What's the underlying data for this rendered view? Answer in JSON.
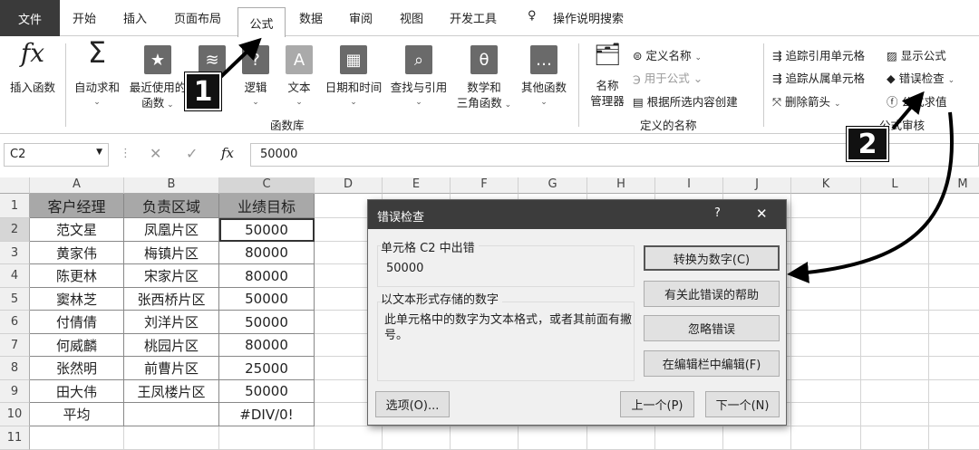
{
  "tabs": {
    "file": "文件",
    "home": "开始",
    "insert": "插入",
    "layout": "页面布局",
    "formulas": "公式",
    "data": "数据",
    "review": "审阅",
    "view": "视图",
    "developer": "开发工具",
    "search": "操作说明搜索"
  },
  "ribbon": {
    "insert_function": "插入函数",
    "autosum": "自动求和",
    "recent1": "最近使用的",
    "recent2": "函数",
    "logic": "逻辑",
    "text": "文本",
    "datetime": "日期和时间",
    "lookup": "查找与引用",
    "math1": "数学和",
    "math2": "三角函数",
    "other": "其他函数",
    "group_lib": "函数库",
    "name_mgr1": "名称",
    "name_mgr2": "管理器",
    "define_name": "定义名称",
    "use_in_formula": "用于公式",
    "create_from_sel": "根据所选内容创建",
    "group_names": "定义的名称",
    "trace_prec": "追踪引用单元格",
    "trace_dep": "追踪从属单元格",
    "remove_arrows": "删除箭头",
    "show_formulas": "显示公式",
    "error_check": "错误检查",
    "eval_formula": "公式求值",
    "group_audit": "公式审核"
  },
  "formula_bar": {
    "name_box": "C2",
    "fx": "fx",
    "value": "50000"
  },
  "columns": [
    "A",
    "B",
    "C",
    "D",
    "E",
    "F",
    "G",
    "H",
    "I",
    "J",
    "K",
    "L",
    "M"
  ],
  "rows": [
    [
      "客户经理",
      "负责区域",
      "业绩目标"
    ],
    [
      "范文星",
      "凤凰片区",
      "50000"
    ],
    [
      "黄家伟",
      "梅镇片区",
      "80000"
    ],
    [
      "陈更林",
      "宋家片区",
      "80000"
    ],
    [
      "窦林芝",
      "张西桥片区",
      "50000"
    ],
    [
      "付倩倩",
      "刘洋片区",
      "50000"
    ],
    [
      "何威麟",
      "桃园片区",
      "80000"
    ],
    [
      "张然明",
      "前曹片区",
      "25000"
    ],
    [
      "田大伟",
      "王凤楼片区",
      "50000"
    ],
    [
      "平均",
      "",
      "#DIV/0!"
    ]
  ],
  "row_numbers": [
    "1",
    "2",
    "3",
    "4",
    "5",
    "6",
    "7",
    "8",
    "9",
    "10",
    "11"
  ],
  "dialog": {
    "title": "错误检查",
    "help": "?",
    "close": "✕",
    "cell_error": "单元格 C2 中出错",
    "cell_value": "50000",
    "error_type": "以文本形式存储的数字",
    "description": "此单元格中的数字为文本格式，或者其前面有撇号。",
    "convert": "转换为数字(C)",
    "about": "有关此错误的帮助",
    "ignore": "忽略错误",
    "edit": "在编辑栏中编辑(F)",
    "options": "选项(O)...",
    "prev": "上一个(P)",
    "next": "下一个(N)"
  },
  "annotations": {
    "step1": "1",
    "step2": "2"
  }
}
